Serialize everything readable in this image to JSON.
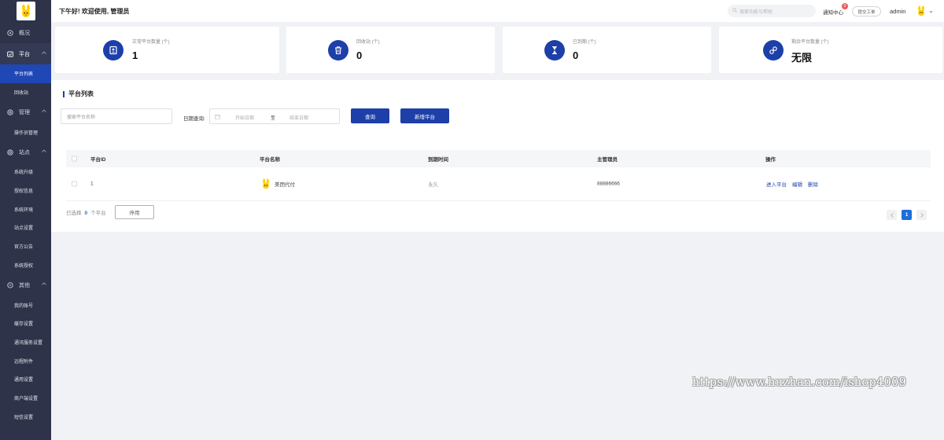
{
  "header": {
    "greeting": "下午好! 欢迎使用, 管理员",
    "search_placeholder": "搜索功能与帮助",
    "notice_label": "通知中心",
    "notice_count": "0",
    "ticket_label": "提交工单",
    "username": "admin"
  },
  "sidebar": {
    "overview": "概况",
    "platform": "平台",
    "platform_items": [
      "平台列表",
      "回收站"
    ],
    "manage": "管理",
    "manage_items": [
      "操作员管理"
    ],
    "site": "站点",
    "site_items": [
      "系统升级",
      "授权信息",
      "系统环境",
      "站点设置",
      "官方公告",
      "系统授权"
    ],
    "other": "其他",
    "other_items": [
      "我的账号",
      "缓存设置",
      "通讯服务设置",
      "远程附件",
      "通用设置",
      "商户端设置",
      "短信设置"
    ]
  },
  "stats": [
    {
      "label": "正常平台数量 (个)",
      "value": "1",
      "icon": "profile-icon"
    },
    {
      "label": "回收站 (个)",
      "value": "0",
      "icon": "trash-icon"
    },
    {
      "label": "已到期 (个)",
      "value": "0",
      "icon": "hourglass-icon"
    },
    {
      "label": "剩余平台数量 (个)",
      "value": "无限",
      "icon": "link-icon"
    }
  ],
  "panel": {
    "title": "平台列表",
    "name_placeholder": "搜索平台名称",
    "date_label": "日期查询:",
    "start_placeholder": "开始日期",
    "range_sep": "至",
    "end_placeholder": "结束日期",
    "query_button": "查询",
    "add_button": "新增平台"
  },
  "table": {
    "headers": [
      "平台ID",
      "平台名称",
      "到期时间",
      "主管理员",
      "操作"
    ],
    "rows": [
      {
        "id": "1",
        "name": "美团代付",
        "expire": "永久",
        "admin": "88886666",
        "actions": [
          "进入平台",
          "编辑",
          "删除"
        ]
      }
    ]
  },
  "footer": {
    "selected_prefix": "已选择",
    "selected_count": "0",
    "selected_suffix": "个平台",
    "disable_button": "停用",
    "current_page": "1"
  },
  "watermark": "https://www.huzhan.com/ishop4009",
  "colors": {
    "accent": "#1d3fa8",
    "sidebar": "#2f3349",
    "active_nav": "#1f47b5",
    "page_blue": "#1d6fd8"
  }
}
